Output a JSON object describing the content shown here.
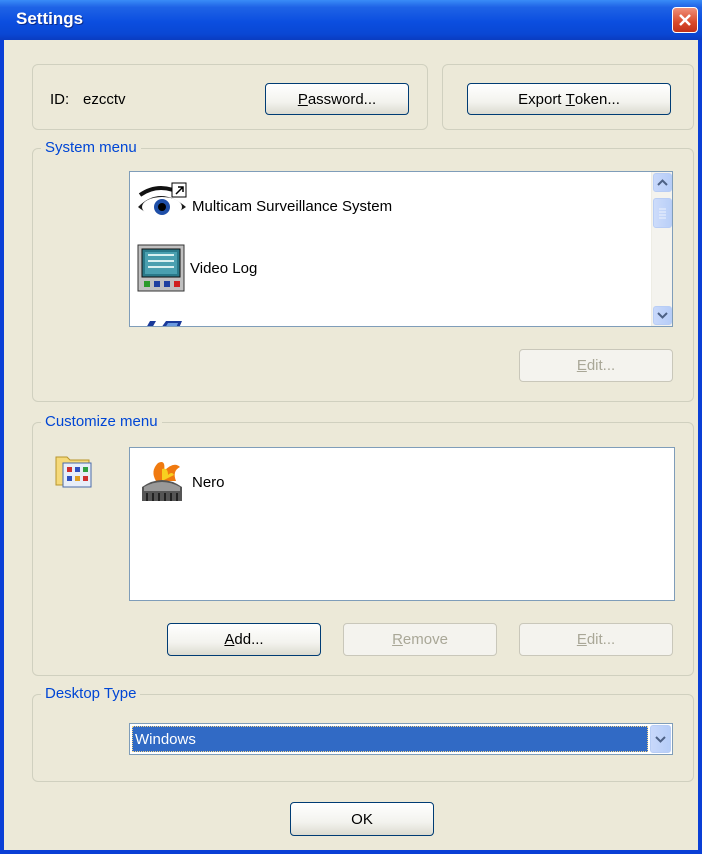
{
  "window": {
    "title": "Settings"
  },
  "account": {
    "id_label": "ID:",
    "id_value": "ezcctv",
    "password_button": {
      "mnemonic": "P",
      "rest": "assword..."
    },
    "export_token_button": {
      "before": "Export ",
      "mnemonic": "T",
      "rest": "oken..."
    }
  },
  "system_menu": {
    "legend": "System menu",
    "items": [
      {
        "label": "Multicam Surveillance System",
        "icon": "eye-icon"
      },
      {
        "label": "Video Log",
        "icon": "video-log-icon"
      },
      {
        "label": "",
        "icon": "partial-icon"
      }
    ],
    "edit_button": {
      "mnemonic": "E",
      "rest": "dit..."
    }
  },
  "customize_menu": {
    "legend": "Customize menu",
    "items": [
      {
        "label": "Nero",
        "icon": "nero-icon"
      }
    ],
    "add_button": {
      "mnemonic": "A",
      "rest": "dd..."
    },
    "remove_button": {
      "mnemonic": "R",
      "rest": "emove"
    },
    "edit_button": {
      "mnemonic": "E",
      "rest": "dit..."
    }
  },
  "desktop_type": {
    "legend": "Desktop Type",
    "selected": "Windows"
  },
  "ok_button": {
    "label": "OK"
  },
  "colors": {
    "title_bar": "#0a47d4",
    "legend_text": "#0046d5",
    "dialog_bg": "#ece9d8",
    "selection": "#316ac5"
  }
}
